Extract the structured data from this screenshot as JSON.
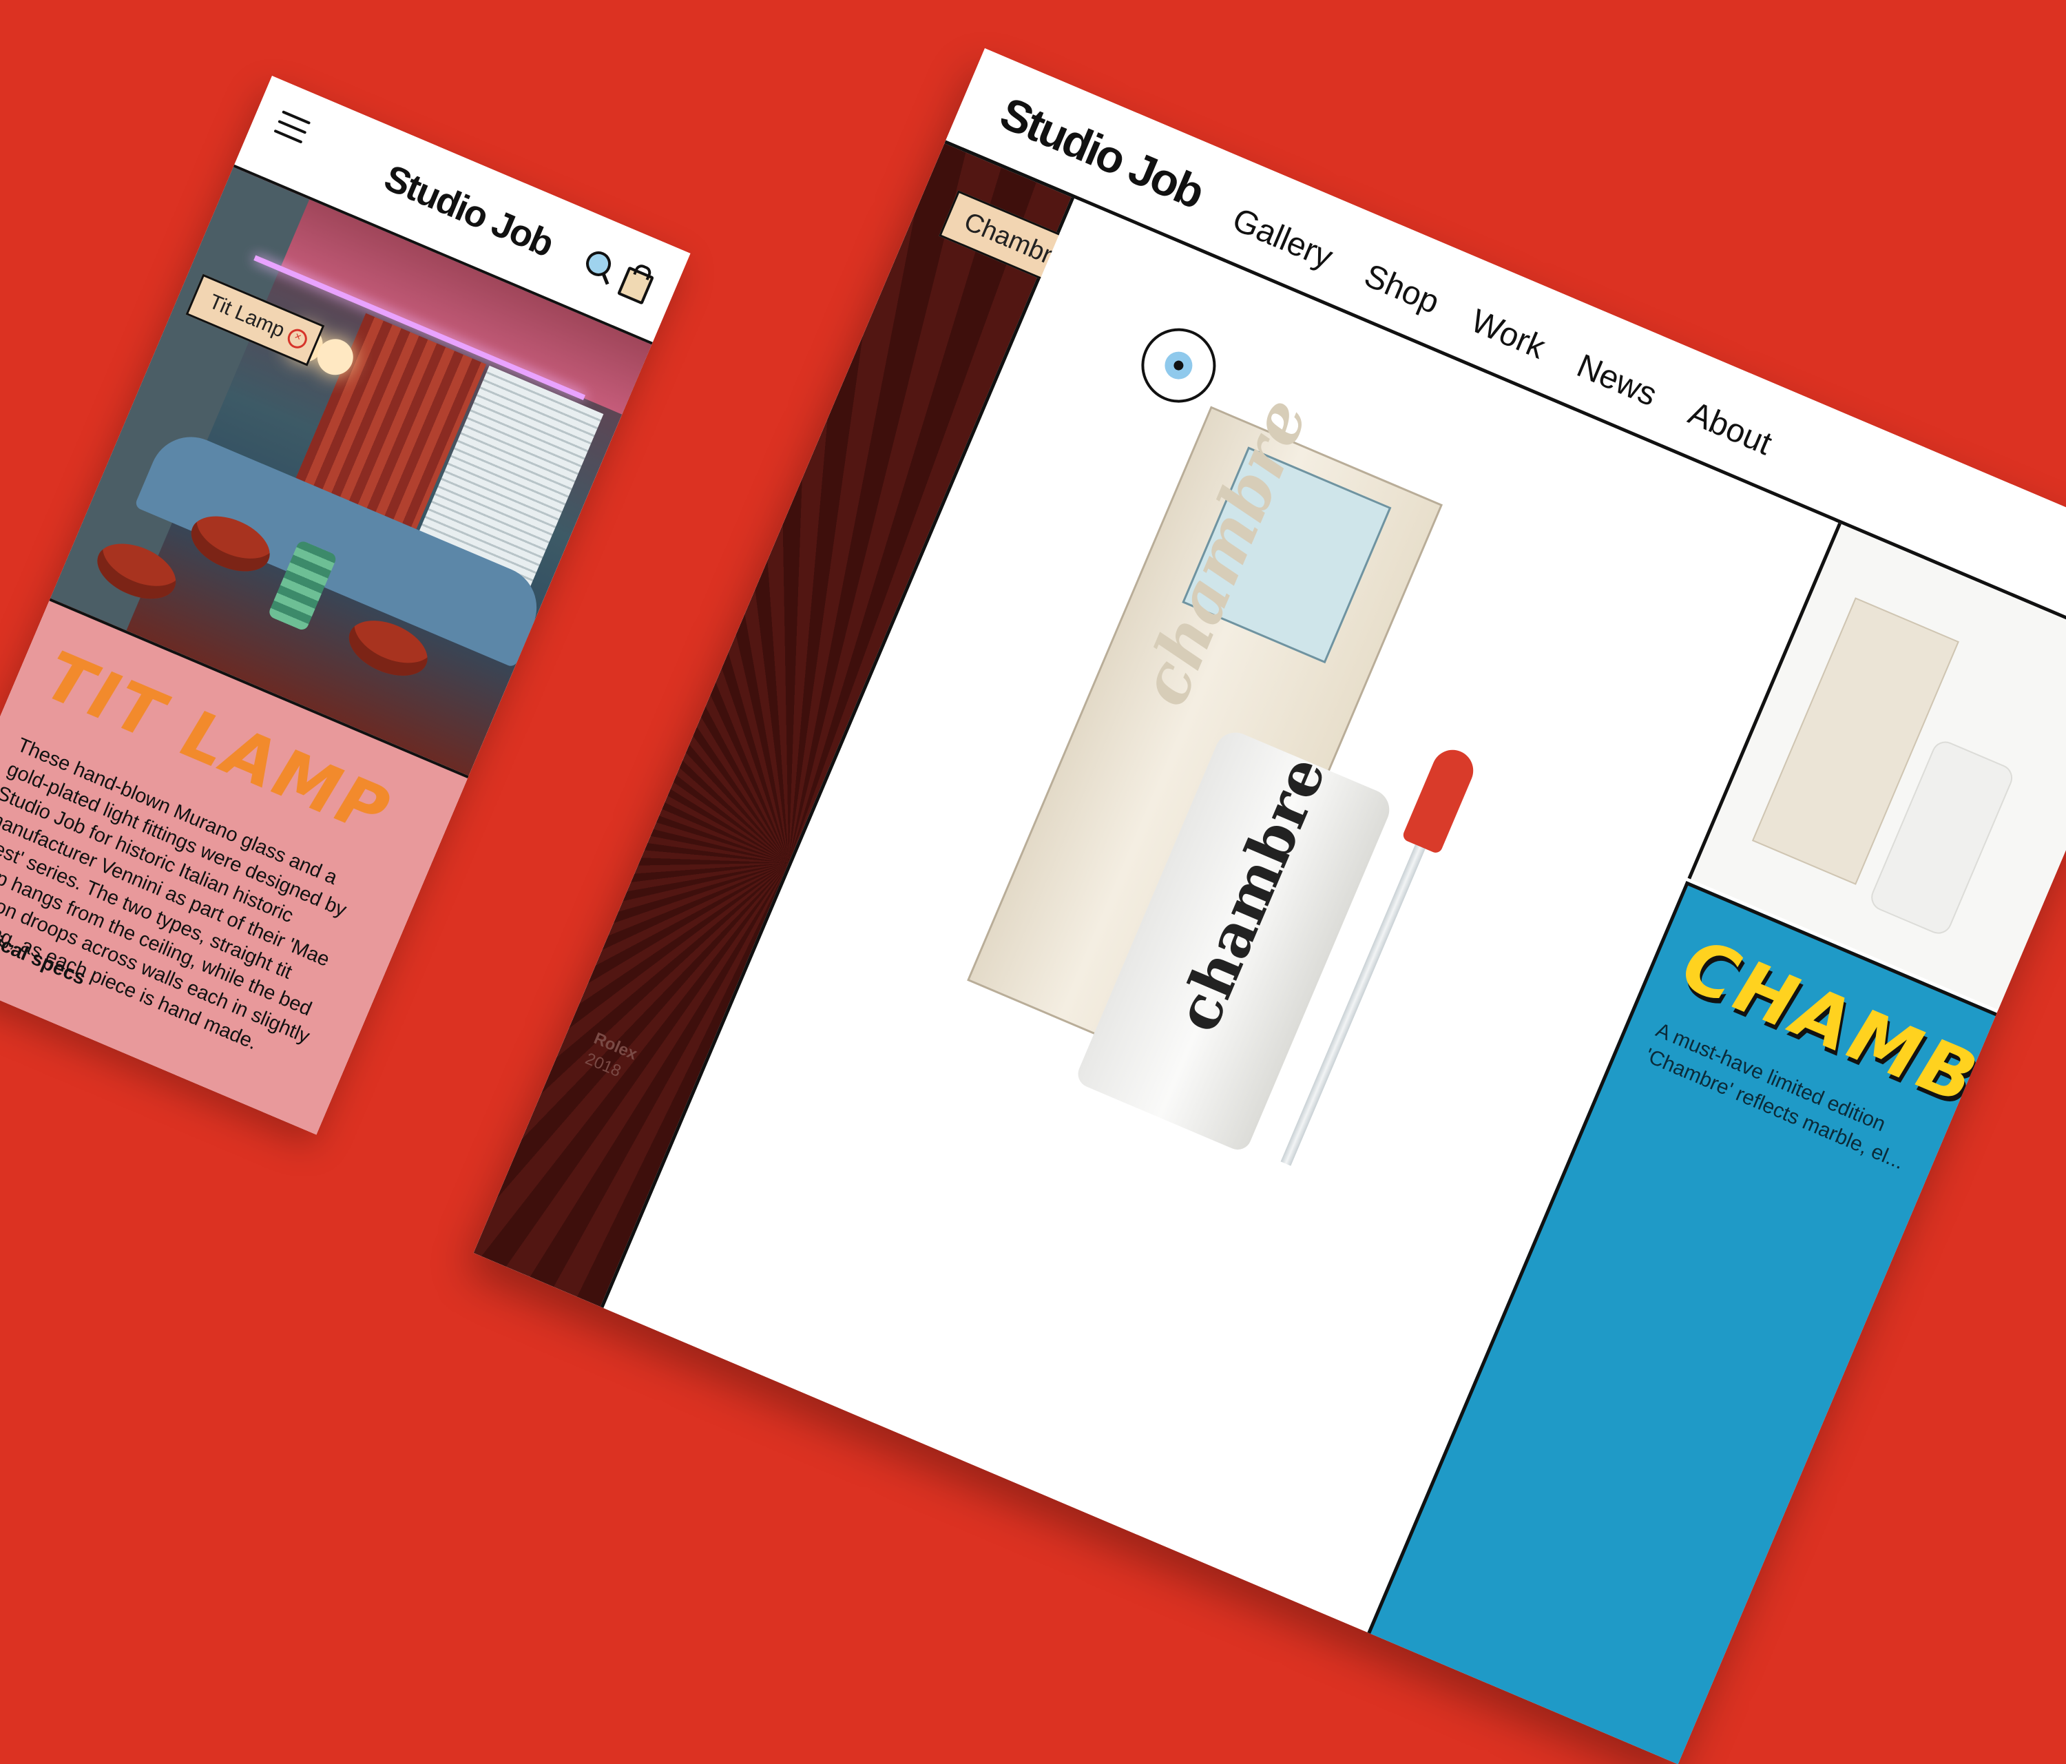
{
  "colors": {
    "background": "#dc3222",
    "mobile_info_bg": "#e8999b",
    "mobile_title": "#f28a2c",
    "desktop_info_bg": "#1f9ac7",
    "desktop_title": "#ffd21f"
  },
  "mobile": {
    "logo": "Studio Job",
    "menu_icon": "hamburger-icon",
    "search_icon": "search-icon",
    "bag_icon": "shopping-bag-icon",
    "tag_label": "Tit Lamp",
    "tag_close": "×",
    "title": "TIT LAMP",
    "description": "These hand-blown Murano glass and a gold-plated light fittings were designed by Studio Job for historic Italian historic manufacturer Vennini as part of their 'Mae West' series. The two types, straight tit lamp hangs from the ceiling, while the bed version droops across walls each in slightly differing, as each piece is hand made.",
    "specs_label": "Technical specs"
  },
  "desktop": {
    "logo": "Studio Job",
    "nav": [
      "Gallery",
      "Shop",
      "Work",
      "News",
      "About"
    ],
    "tag_label": "Chambre",
    "tag_close": "×",
    "sidebar_label": "Rolex",
    "sidebar_year": "2018",
    "box_word": "chambre",
    "bottle_word": "chambre",
    "title": "CHAMBRE",
    "description": "A must-have limited edition 'Chambre' reflects marble, el..."
  }
}
